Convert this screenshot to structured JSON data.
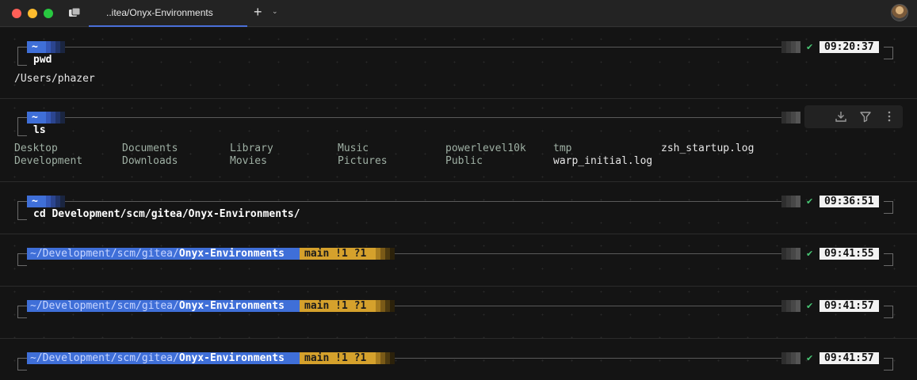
{
  "window": {
    "tab_title": "..itea/Onyx-Environments",
    "new_tab_label": "+",
    "new_tab_chevron": "⌄"
  },
  "colors": {
    "accent": "#3f6fd8",
    "git": "#d5a12c",
    "check": "#48c774"
  },
  "blocks": [
    {
      "home": "~",
      "command": "pwd",
      "output": "/Users/phazer",
      "status": "✔",
      "time": "09:20:37"
    },
    {
      "home": "~",
      "command": "ls",
      "ls_columns": [
        [
          "Desktop",
          "Development"
        ],
        [
          "Documents",
          "Downloads"
        ],
        [
          "Library",
          "Movies"
        ],
        [
          "Music",
          "Pictures"
        ],
        [
          "powerlevel10k",
          "Public"
        ],
        [
          "tmp",
          "warp_initial.log"
        ],
        [
          "zsh_startup.log",
          ""
        ]
      ],
      "toolbar_icons": [
        "download-icon",
        "filter-icon",
        "more-icon"
      ]
    },
    {
      "home": "~",
      "command": "cd Development/scm/gitea/Onyx-Environments/",
      "status": "✔",
      "time": "09:36:51"
    },
    {
      "path_prefix": "~/Development/scm/gitea/",
      "path_leaf": "Onyx-Environments",
      "git": "main !1 ?1",
      "status": "✔",
      "time": "09:41:55"
    },
    {
      "path_prefix": "~/Development/scm/gitea/",
      "path_leaf": "Onyx-Environments",
      "git": "main !1 ?1",
      "status": "✔",
      "time": "09:41:57"
    },
    {
      "path_prefix": "~/Development/scm/gitea/",
      "path_leaf": "Onyx-Environments",
      "git": "main !1 ?1",
      "status": "✔",
      "time": "09:41:57"
    }
  ]
}
